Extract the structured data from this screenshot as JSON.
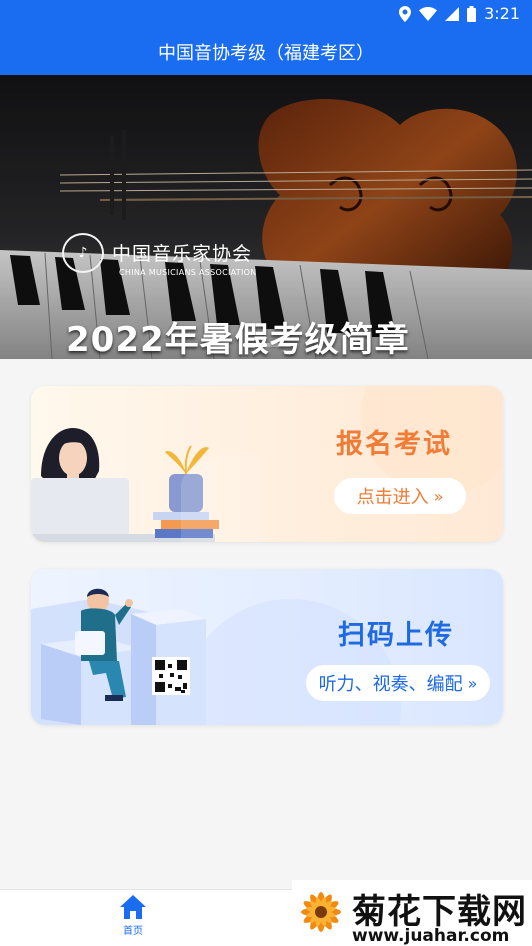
{
  "status_bar": {
    "time": "3:21",
    "icons": [
      "location-icon",
      "wifi-icon",
      "signal-icon",
      "battery-icon"
    ]
  },
  "app_bar": {
    "title": "中国音协考级（福建考区）"
  },
  "banner": {
    "org_cn": "中国音乐家协会",
    "org_en": "CHINA MUSICIANS ASSOCIATION",
    "title": "2022年暑假考级简章",
    "slide_count": 2,
    "active_slide": 1
  },
  "cards": {
    "signup": {
      "title": "报名考试",
      "action": "点击进入",
      "chevron": "»"
    },
    "upload": {
      "title": "扫码上传",
      "action": "听力、视奏、编配",
      "chevron": "»"
    }
  },
  "tab_bar": {
    "home_label": "首页",
    "home_icon": "home-icon",
    "active_color": "#1a6cf0"
  },
  "watermark": {
    "text": "菊花下载网",
    "url": "www.juahar.com"
  },
  "colors": {
    "primary": "#1a6cf0",
    "signup_accent": "#f07c36",
    "upload_accent": "#1f6ae3"
  }
}
